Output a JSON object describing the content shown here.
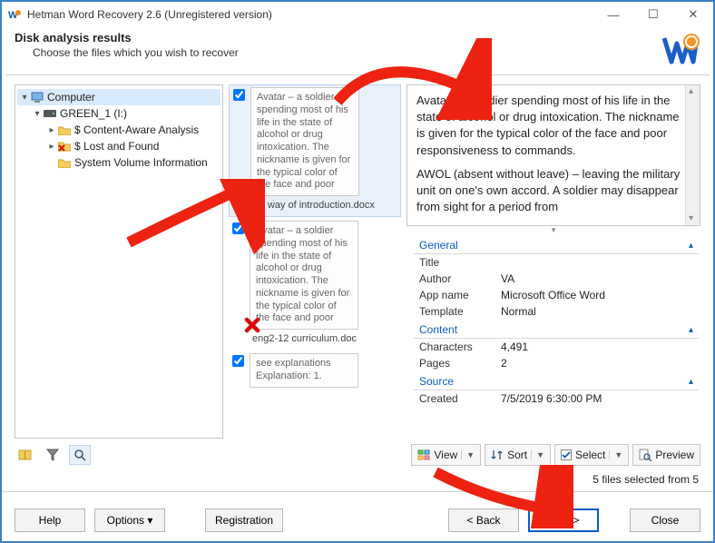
{
  "window": {
    "title": "Hetman Word Recovery 2.6 (Unregistered version)"
  },
  "header": {
    "title": "Disk analysis results",
    "subtitle": "Choose the files which you wish to recover"
  },
  "tree": {
    "root": "Computer",
    "drive": "GREEN_1 (I:)",
    "items": [
      "$ Content-Aware Analysis",
      "$ Lost and Found",
      "System Volume Information"
    ]
  },
  "thumbs": [
    {
      "checked": true,
      "preview": "Avatar – a soldier spending most of his life in the state of alcohol or drug intoxication. The nickname is given for the typical color of the face and poor",
      "filename": "By way of introduction.docx",
      "deleted": true,
      "selected": true
    },
    {
      "checked": true,
      "preview": "Avatar – a soldier spending most of his life in the state of alcohol or drug intoxication. The nickname is given for the typical color of the face and poor",
      "filename": "eng2-12 curriculum.doc",
      "deleted": true,
      "selected": false
    },
    {
      "checked": true,
      "preview": "see explanations Explanation: 1.",
      "filename": "",
      "deleted": false,
      "selected": false
    }
  ],
  "preview": {
    "p1": "Avatar – a soldier spending most of his life in the state of alcohol or drug intoxication. The nickname is given for the typical color of the face and poor responsiveness to commands.",
    "p2": "AWOL (absent without leave) – leaving the military unit on one's own accord. A soldier may disappear from sight for a period from"
  },
  "sections": {
    "general": "General",
    "content": "Content",
    "source": "Source"
  },
  "props_general": {
    "title_k": "Title",
    "title_v": "",
    "author_k": "Author",
    "author_v": "VA",
    "app_k": "App name",
    "app_v": "Microsoft Office Word",
    "tpl_k": "Template",
    "tpl_v": "Normal"
  },
  "props_content": {
    "chars_k": "Characters",
    "chars_v": "4,491",
    "pages_k": "Pages",
    "pages_v": "2"
  },
  "props_source": {
    "created_k": "Created",
    "created_v": "7/5/2019 6:30:00 PM"
  },
  "right_toolbar": {
    "view": "View",
    "sort": "Sort",
    "select": "Select",
    "preview": "Preview"
  },
  "status": "5 files selected from 5",
  "footer": {
    "help": "Help",
    "options": "Options ▾",
    "registration": "Registration",
    "back": "< Back",
    "next": "Next >",
    "close": "Close"
  }
}
